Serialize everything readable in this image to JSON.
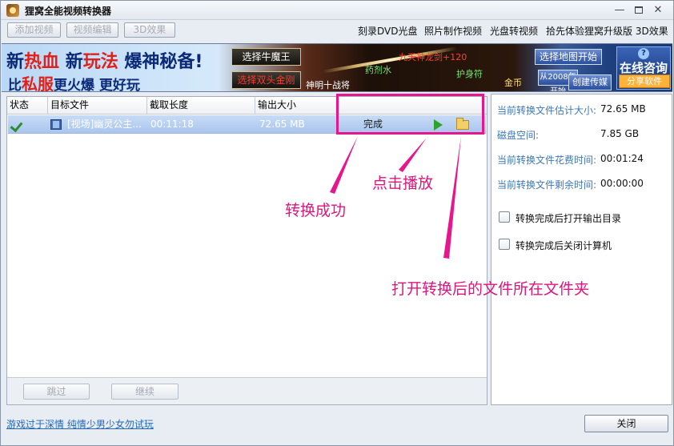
{
  "window": {
    "title": "狸窝全能视频转换器",
    "controls": {
      "minimize": "—",
      "maximize": "",
      "close": "✕"
    }
  },
  "toolbar": {
    "buttons": [
      "添加视频",
      "视频编辑",
      "3D效果"
    ],
    "links": [
      "刻录DVD光盘",
      "照片制作视频",
      "光盘转视频",
      "拾先体验狸窝升级版 3D效果"
    ]
  },
  "banner": {
    "slogan_line1": {
      "a": "新",
      "b": "热血",
      "c": " 新",
      "d": "玩法",
      "e": " 爆神秘备!"
    },
    "slogan_line2": {
      "a": "比",
      "b": "私服",
      "c": "更火爆 更好玩"
    },
    "buttons": [
      "选择牛魔王",
      "选择双头金刚"
    ],
    "game_texts": [
      "药剂水",
      "九天神龙剑+120",
      "护身符",
      "神明十战将",
      "金币"
    ],
    "right_buttons": [
      "选择地图开始",
      "从2008年开始",
      "创建传媒"
    ],
    "consult": {
      "icon": "?",
      "label": "在线咨询"
    },
    "share": "分享软件"
  },
  "table": {
    "columns": [
      "状态",
      "目标文件",
      "截取长度",
      "输出大小",
      ""
    ],
    "rows": [
      {
        "file": "[视场]幽灵公主...",
        "length": "00:11:18",
        "size": "72.65 MB",
        "status": "完成"
      }
    ],
    "actions": [
      "跳过",
      "继续"
    ]
  },
  "info": {
    "rows": [
      {
        "label": "当前转换文件估计大小:",
        "value": "72.65 MB"
      },
      {
        "label": "磁盘空间:",
        "value": "7.85 GB"
      },
      {
        "label": "当前转换文件花费时间:",
        "value": "00:01:24"
      },
      {
        "label": "当前转换文件剩余时间:",
        "value": "00:00:00"
      }
    ],
    "options": [
      "转换完成后打开输出目录",
      "转换完成后关闭计算机"
    ]
  },
  "annotations": {
    "success": "转换成功",
    "play": "点击播放",
    "folder": "打开转换后的文件所在文件夹"
  },
  "footer": {
    "link": "游戏过于深情 纯情少男少女勿试玩",
    "close": "关闭"
  },
  "colors": {
    "annotation": "#e0147e",
    "selected_row": "#a9c6ee",
    "info_label": "#3d78b8"
  }
}
